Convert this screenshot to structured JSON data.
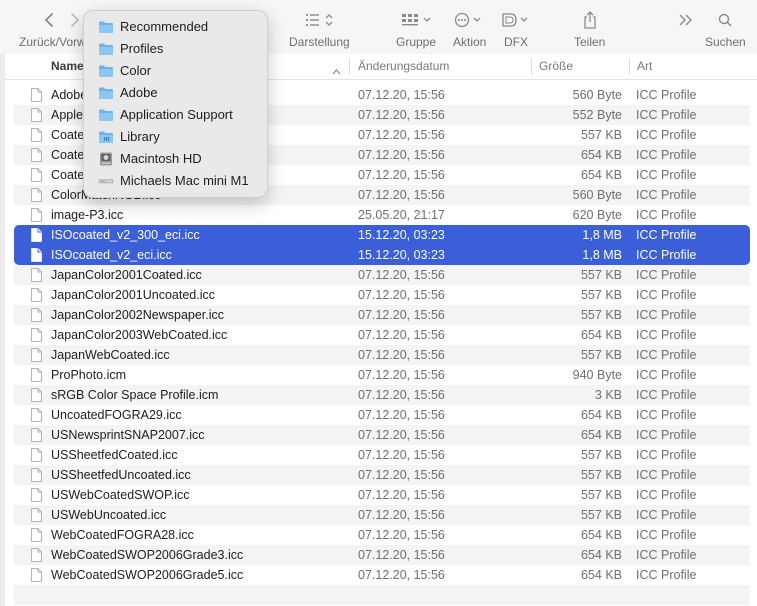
{
  "toolbar": {
    "back_forward_label": "Zurück/Vorwärts",
    "view_label": "Darstellung",
    "group_label": "Gruppe",
    "action_label": "Aktion",
    "dfx_label": "DFX",
    "share_label": "Teilen",
    "search_label": "Suchen"
  },
  "columns": {
    "name": "Name",
    "date": "Änderungsdatum",
    "size": "Größe",
    "kind": "Art"
  },
  "path_menu": {
    "items": [
      {
        "label": "Recommended",
        "icon": "folder-icon"
      },
      {
        "label": "Profiles",
        "icon": "folder-icon"
      },
      {
        "label": "Color",
        "icon": "folder-icon"
      },
      {
        "label": "Adobe",
        "icon": "folder-icon"
      },
      {
        "label": "Application Support",
        "icon": "folder-icon"
      },
      {
        "label": "Library",
        "icon": "library-folder-icon"
      },
      {
        "label": "Macintosh HD",
        "icon": "hard-drive-icon"
      },
      {
        "label": "Michaels Mac mini M1",
        "icon": "computer-icon"
      }
    ]
  },
  "files": [
    {
      "name": "Adobe",
      "date": "07.12.20, 15:56",
      "size": "560 Byte",
      "kind": "ICC Profile"
    },
    {
      "name": "Apple",
      "date": "07.12.20, 15:56",
      "size": "552 Byte",
      "kind": "ICC Profile"
    },
    {
      "name": "Coate",
      "date": "07.12.20, 15:56",
      "size": "557 KB",
      "kind": "ICC Profile"
    },
    {
      "name": "Coate",
      "date": "07.12.20, 15:56",
      "size": "654 KB",
      "kind": "ICC Profile"
    },
    {
      "name": "Coate",
      "date": "07.12.20, 15:56",
      "size": "654 KB",
      "kind": "ICC Profile"
    },
    {
      "name": "ColorMatchRGB.icc",
      "date": "07.12.20, 15:56",
      "size": "560 Byte",
      "kind": "ICC Profile"
    },
    {
      "name": "image-P3.icc",
      "date": "25.05.20, 21:17",
      "size": "620 Byte",
      "kind": "ICC Profile"
    },
    {
      "name": "ISOcoated_v2_300_eci.icc",
      "date": "15.12.20, 03:23",
      "size": "1,8 MB",
      "kind": "ICC Profile",
      "selected": true
    },
    {
      "name": "ISOcoated_v2_eci.icc",
      "date": "15.12.20, 03:23",
      "size": "1,8 MB",
      "kind": "ICC Profile",
      "selected": true
    },
    {
      "name": "JapanColor2001Coated.icc",
      "date": "07.12.20, 15:56",
      "size": "557 KB",
      "kind": "ICC Profile"
    },
    {
      "name": "JapanColor2001Uncoated.icc",
      "date": "07.12.20, 15:56",
      "size": "557 KB",
      "kind": "ICC Profile"
    },
    {
      "name": "JapanColor2002Newspaper.icc",
      "date": "07.12.20, 15:56",
      "size": "557 KB",
      "kind": "ICC Profile"
    },
    {
      "name": "JapanColor2003WebCoated.icc",
      "date": "07.12.20, 15:56",
      "size": "654 KB",
      "kind": "ICC Profile"
    },
    {
      "name": "JapanWebCoated.icc",
      "date": "07.12.20, 15:56",
      "size": "557 KB",
      "kind": "ICC Profile"
    },
    {
      "name": "ProPhoto.icm",
      "date": "07.12.20, 15:56",
      "size": "940 Byte",
      "kind": "ICC Profile"
    },
    {
      "name": "sRGB Color Space Profile.icm",
      "date": "07.12.20, 15:56",
      "size": "3 KB",
      "kind": "ICC Profile"
    },
    {
      "name": "UncoatedFOGRA29.icc",
      "date": "07.12.20, 15:56",
      "size": "654 KB",
      "kind": "ICC Profile"
    },
    {
      "name": "USNewsprintSNAP2007.icc",
      "date": "07.12.20, 15:56",
      "size": "654 KB",
      "kind": "ICC Profile"
    },
    {
      "name": "USSheetfedCoated.icc",
      "date": "07.12.20, 15:56",
      "size": "557 KB",
      "kind": "ICC Profile"
    },
    {
      "name": "USSheetfedUncoated.icc",
      "date": "07.12.20, 15:56",
      "size": "557 KB",
      "kind": "ICC Profile"
    },
    {
      "name": "USWebCoatedSWOP.icc",
      "date": "07.12.20, 15:56",
      "size": "557 KB",
      "kind": "ICC Profile"
    },
    {
      "name": "USWebUncoated.icc",
      "date": "07.12.20, 15:56",
      "size": "557 KB",
      "kind": "ICC Profile"
    },
    {
      "name": "WebCoatedFOGRA28.icc",
      "date": "07.12.20, 15:56",
      "size": "654 KB",
      "kind": "ICC Profile"
    },
    {
      "name": "WebCoatedSWOP2006Grade3.icc",
      "date": "07.12.20, 15:56",
      "size": "654 KB",
      "kind": "ICC Profile"
    },
    {
      "name": "WebCoatedSWOP2006Grade5.icc",
      "date": "07.12.20, 15:56",
      "size": "654 KB",
      "kind": "ICC Profile"
    }
  ],
  "colors": {
    "selection": "#3a5fd9",
    "folder": "#6fb3ec"
  }
}
